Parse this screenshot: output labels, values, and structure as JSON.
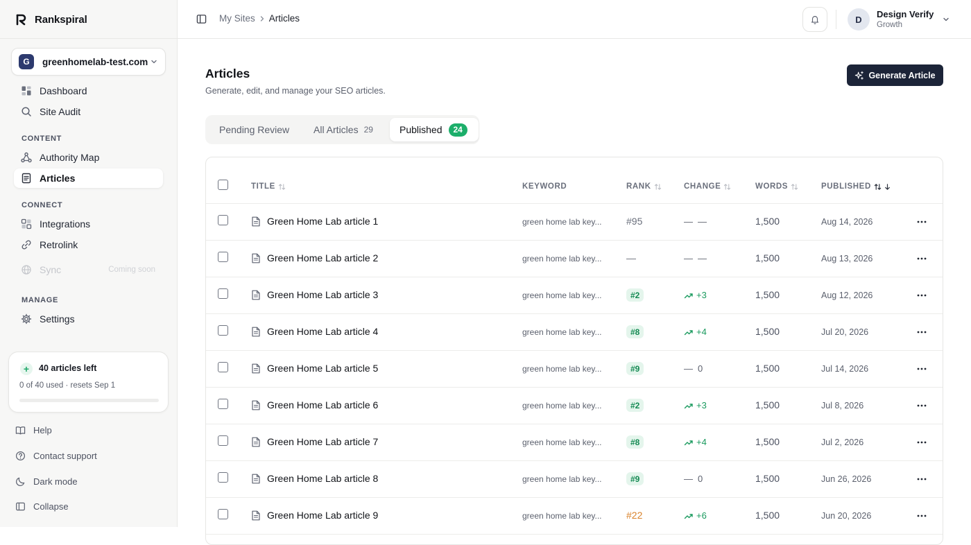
{
  "brand": {
    "name": "Rankspiral"
  },
  "site_switcher": {
    "avatar_letter": "G",
    "name": "greenhomelab-test.com"
  },
  "nav": {
    "dashboard": "Dashboard",
    "site_audit": "Site Audit",
    "content_section": "CONTENT",
    "authority_map": "Authority Map",
    "articles": "Articles",
    "connect_section": "CONNECT",
    "integrations": "Integrations",
    "retrolink": "Retrolink",
    "sync": "Sync",
    "sync_badge": "Coming soon",
    "manage_section": "MANAGE",
    "settings": "Settings"
  },
  "quota": {
    "title": "40 articles left",
    "subtitle": "0 of 40 used · resets Sep 1",
    "used_fraction": 0
  },
  "footer_nav": {
    "help": "Help",
    "contact": "Contact support",
    "dark_mode": "Dark mode",
    "collapse": "Collapse"
  },
  "breadcrumb": {
    "parent": "My Sites",
    "current": "Articles"
  },
  "user": {
    "avatar_letter": "D",
    "name": "Design Verify",
    "plan": "Growth"
  },
  "page": {
    "title": "Articles",
    "subtitle": "Generate, edit, and manage your SEO articles.",
    "generate_button": "Generate Article"
  },
  "tabs": [
    {
      "label": "Pending Review",
      "count": ""
    },
    {
      "label": "All Articles",
      "count": "29"
    },
    {
      "label": "Published",
      "count": "24"
    }
  ],
  "table": {
    "columns": {
      "title": "TITLE",
      "keyword": "KEYWORD",
      "rank": "RANK",
      "change": "CHANGE",
      "words": "WORDS",
      "published": "PUBLISHED"
    },
    "rows": [
      {
        "title": "Green Home Lab article 1",
        "keyword": "green home lab key...",
        "rank": "#95",
        "rank_style": "plain",
        "change_icon": "dash",
        "change": "—",
        "words": "1,500",
        "date": "Aug 14, 2026"
      },
      {
        "title": "Green Home Lab article 2",
        "keyword": "green home lab key...",
        "rank": "—",
        "rank_style": "plain",
        "change_icon": "dash",
        "change": "—",
        "words": "1,500",
        "date": "Aug 13, 2026"
      },
      {
        "title": "Green Home Lab article 3",
        "keyword": "green home lab key...",
        "rank": "#2",
        "rank_style": "good",
        "change_icon": "trend-up",
        "change": "+3",
        "words": "1,500",
        "date": "Aug 12, 2026"
      },
      {
        "title": "Green Home Lab article 4",
        "keyword": "green home lab key...",
        "rank": "#8",
        "rank_style": "good",
        "change_icon": "trend-up",
        "change": "+4",
        "words": "1,500",
        "date": "Jul 20, 2026"
      },
      {
        "title": "Green Home Lab article 5",
        "keyword": "green home lab key...",
        "rank": "#9",
        "rank_style": "good",
        "change_icon": "dash",
        "change": "0",
        "words": "1,500",
        "date": "Jul 14, 2026"
      },
      {
        "title": "Green Home Lab article 6",
        "keyword": "green home lab key...",
        "rank": "#2",
        "rank_style": "good",
        "change_icon": "trend-up",
        "change": "+3",
        "words": "1,500",
        "date": "Jul 8, 2026"
      },
      {
        "title": "Green Home Lab article 7",
        "keyword": "green home lab key...",
        "rank": "#8",
        "rank_style": "good",
        "change_icon": "trend-up",
        "change": "+4",
        "words": "1,500",
        "date": "Jul 2, 2026"
      },
      {
        "title": "Green Home Lab article 8",
        "keyword": "green home lab key...",
        "rank": "#9",
        "rank_style": "good",
        "change_icon": "dash",
        "change": "0",
        "words": "1,500",
        "date": "Jun 26, 2026"
      },
      {
        "title": "Green Home Lab article 9",
        "keyword": "green home lab key...",
        "rank": "#22",
        "rank_style": "warn",
        "change_icon": "trend-up",
        "change": "+6",
        "words": "1,500",
        "date": "Jun 20, 2026"
      }
    ]
  },
  "colors": {
    "accent_green": "#1cae6a",
    "primary_button": "#1c2438",
    "rank_warn": "#d9822b"
  }
}
